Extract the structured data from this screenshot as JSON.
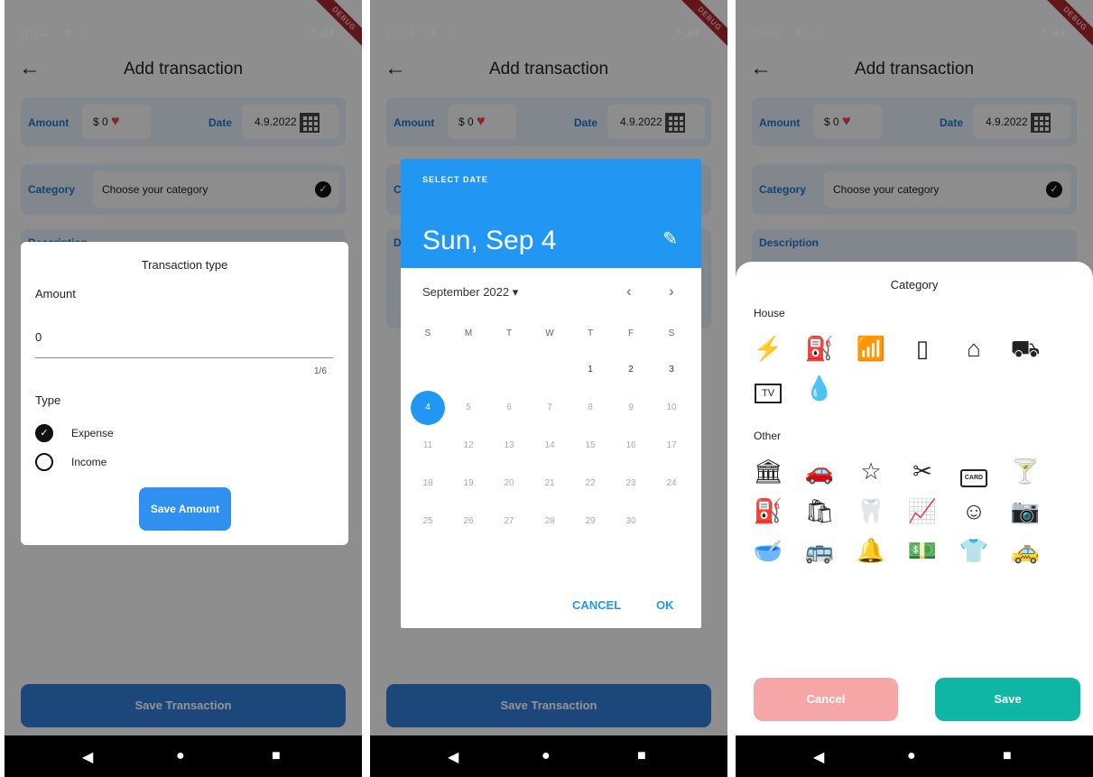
{
  "status": {
    "time": "10:04",
    "icons": "■ 5",
    "signal": "▼◢▮",
    "debug": "DEBUG"
  },
  "appbar": {
    "back": "←",
    "title": "Add transaction"
  },
  "amount_row": {
    "amount_label": "Amount",
    "amount_value": "$ 0",
    "date_label": "Date",
    "date_value": "4.9.2022"
  },
  "category_row": {
    "label": "Category",
    "value": "Choose your category"
  },
  "description": {
    "label": "Description"
  },
  "save_transaction": "Save Transaction",
  "nav": {
    "back": "◀",
    "home": "●",
    "recents": "■"
  },
  "amount_dialog": {
    "title": "Transaction type",
    "amount_label": "Amount",
    "amount_value": "0",
    "counter": "1/6",
    "type_label": "Type",
    "options": [
      "Expense",
      "Income"
    ],
    "selected": "Expense",
    "save_label": "Save Amount"
  },
  "date_picker": {
    "header_label": "SELECT DATE",
    "selected_date": "Sun, Sep 4",
    "month_label": "September 2022 ▾",
    "weekdays": [
      "S",
      "M",
      "T",
      "W",
      "T",
      "F",
      "S"
    ],
    "days": [
      "1",
      "2",
      "3",
      "4",
      "5",
      "6",
      "7",
      "8",
      "9",
      "10",
      "11",
      "12",
      "13",
      "14",
      "15",
      "16",
      "17",
      "18",
      "19",
      "20",
      "21",
      "22",
      "23",
      "24",
      "25",
      "26",
      "27",
      "28",
      "29",
      "30"
    ],
    "cancel": "CANCEL",
    "ok": "OK",
    "colors": {
      "accent": "#2196f3"
    }
  },
  "category_sheet": {
    "title": "Category",
    "house_label": "House",
    "house_icons": [
      "electricity-icon",
      "gas-bottle-icon",
      "router-icon",
      "phone-icon",
      "house-icon",
      "moving-truck-icon",
      "tv-icon",
      "water-icon"
    ],
    "tv_text": "TV",
    "other_label": "Other",
    "other_icons": [
      "bank-icon",
      "car-icon",
      "star-icon",
      "barber-icon",
      "card-icon",
      "drink-icon",
      "fuel-icon",
      "groceries-icon",
      "dentist-icon",
      "investment-icon",
      "baby-icon",
      "camera-icon",
      "pet-food-icon",
      "bus-icon",
      "restaurant-icon",
      "money-plant-icon",
      "clothing-sale-icon",
      "taxi-icon"
    ],
    "card_text": "CARD",
    "cancel": "Cancel",
    "save": "Save",
    "colors": {
      "cancel": "#f7a6a8",
      "save": "#0fb6a6"
    }
  }
}
